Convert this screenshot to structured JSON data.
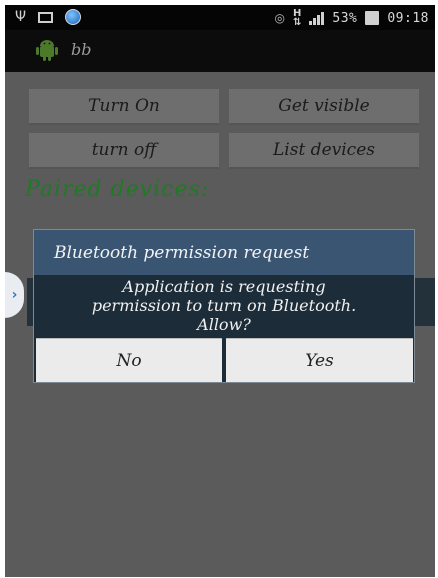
{
  "status_bar": {
    "icons": [
      "usb-icon",
      "picture-icon",
      "shield-app-icon",
      "eye-icon",
      "hspa-plus-icon",
      "signal-icon",
      "battery-icon"
    ],
    "hspa": "H",
    "battery_percent": "53%",
    "time": "09:18"
  },
  "action_bar": {
    "title": "bb",
    "icon": "android-icon"
  },
  "buttons": {
    "turn_on": "Turn On",
    "get_visible": "Get visible",
    "turn_off": "turn off",
    "list_devices": "List devices"
  },
  "paired_label": "Paired devices:",
  "dialog": {
    "title": "Bluetooth permission request",
    "message": "Application is requesting\npermission to turn on Bluetooth.\nAllow?",
    "no_label": "No",
    "yes_label": "Yes"
  },
  "colors": {
    "dialog_title_bg": "#3a5572",
    "dialog_body_bg": "#1c2c38",
    "paired_text": "#1f7a24",
    "screen_dim_bg": "#5b5b5b"
  }
}
